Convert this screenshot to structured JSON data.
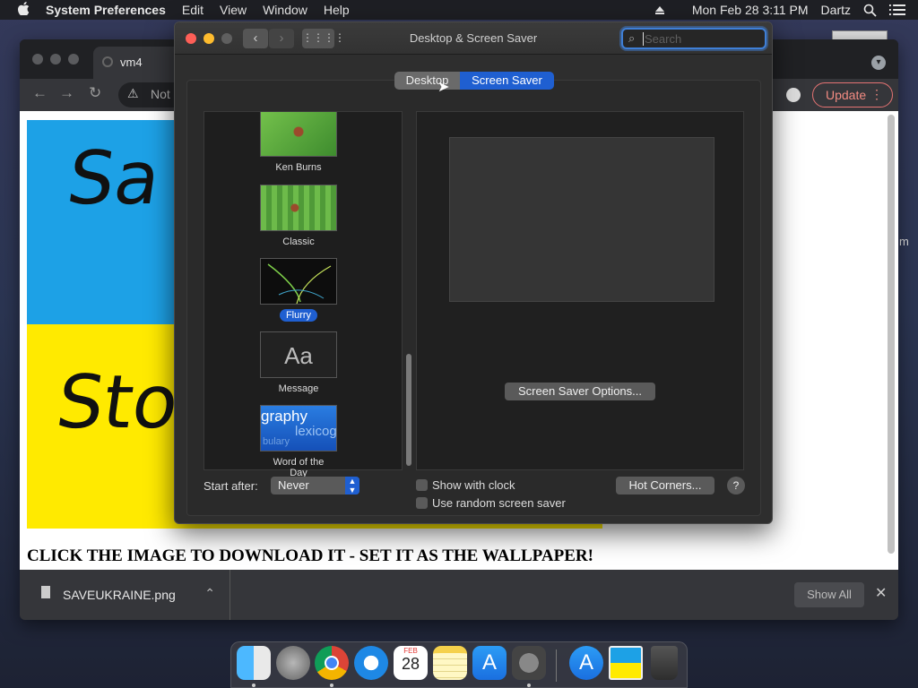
{
  "menubar": {
    "app_name": "System Preferences",
    "menus": [
      "Edit",
      "View",
      "Window",
      "Help"
    ],
    "datetime": "Mon Feb 28  3:11 PM",
    "user": "Dartz"
  },
  "browser": {
    "tab_title": "vm4",
    "omnibox_text": "Not S",
    "update_label": "Update",
    "image_text_top": "Sa",
    "image_text_bottom": "Sto",
    "caption": "CLICK THE IMAGE TO DOWNLOAD IT - SET IT AS THE WALLPAPER!",
    "download_filename": "SAVEUKRAINE.png",
    "show_all_label": "Show All",
    "image_colors": {
      "top": "#1da1e6",
      "bottom": "#ffea00"
    }
  },
  "sysprefs": {
    "title": "Desktop & Screen Saver",
    "search_placeholder": "Search",
    "tabs": {
      "desktop": "Desktop",
      "screen_saver": "Screen Saver",
      "active": "Screen Saver"
    },
    "screen_savers": [
      {
        "name": "Ken Burns",
        "selected": false
      },
      {
        "name": "Classic",
        "selected": false
      },
      {
        "name": "Flurry",
        "selected": true
      },
      {
        "name": "Message",
        "selected": false
      },
      {
        "name": "Word of the Day",
        "selected": false
      }
    ],
    "message_thumb_text": "Aa",
    "word_thumb_text_1": "graphy",
    "word_thumb_text_2": "lexicog",
    "word_thumb_text_3": "bulary",
    "options_button": "Screen Saver Options...",
    "start_after_label": "Start after:",
    "start_after_value": "Never",
    "show_with_clock": "Show with clock",
    "use_random": "Use random screen saver",
    "hot_corners": "Hot Corners...",
    "help": "?"
  },
  "dock": {
    "calendar_month": "FEB",
    "calendar_day": "28"
  },
  "side_text": "m"
}
